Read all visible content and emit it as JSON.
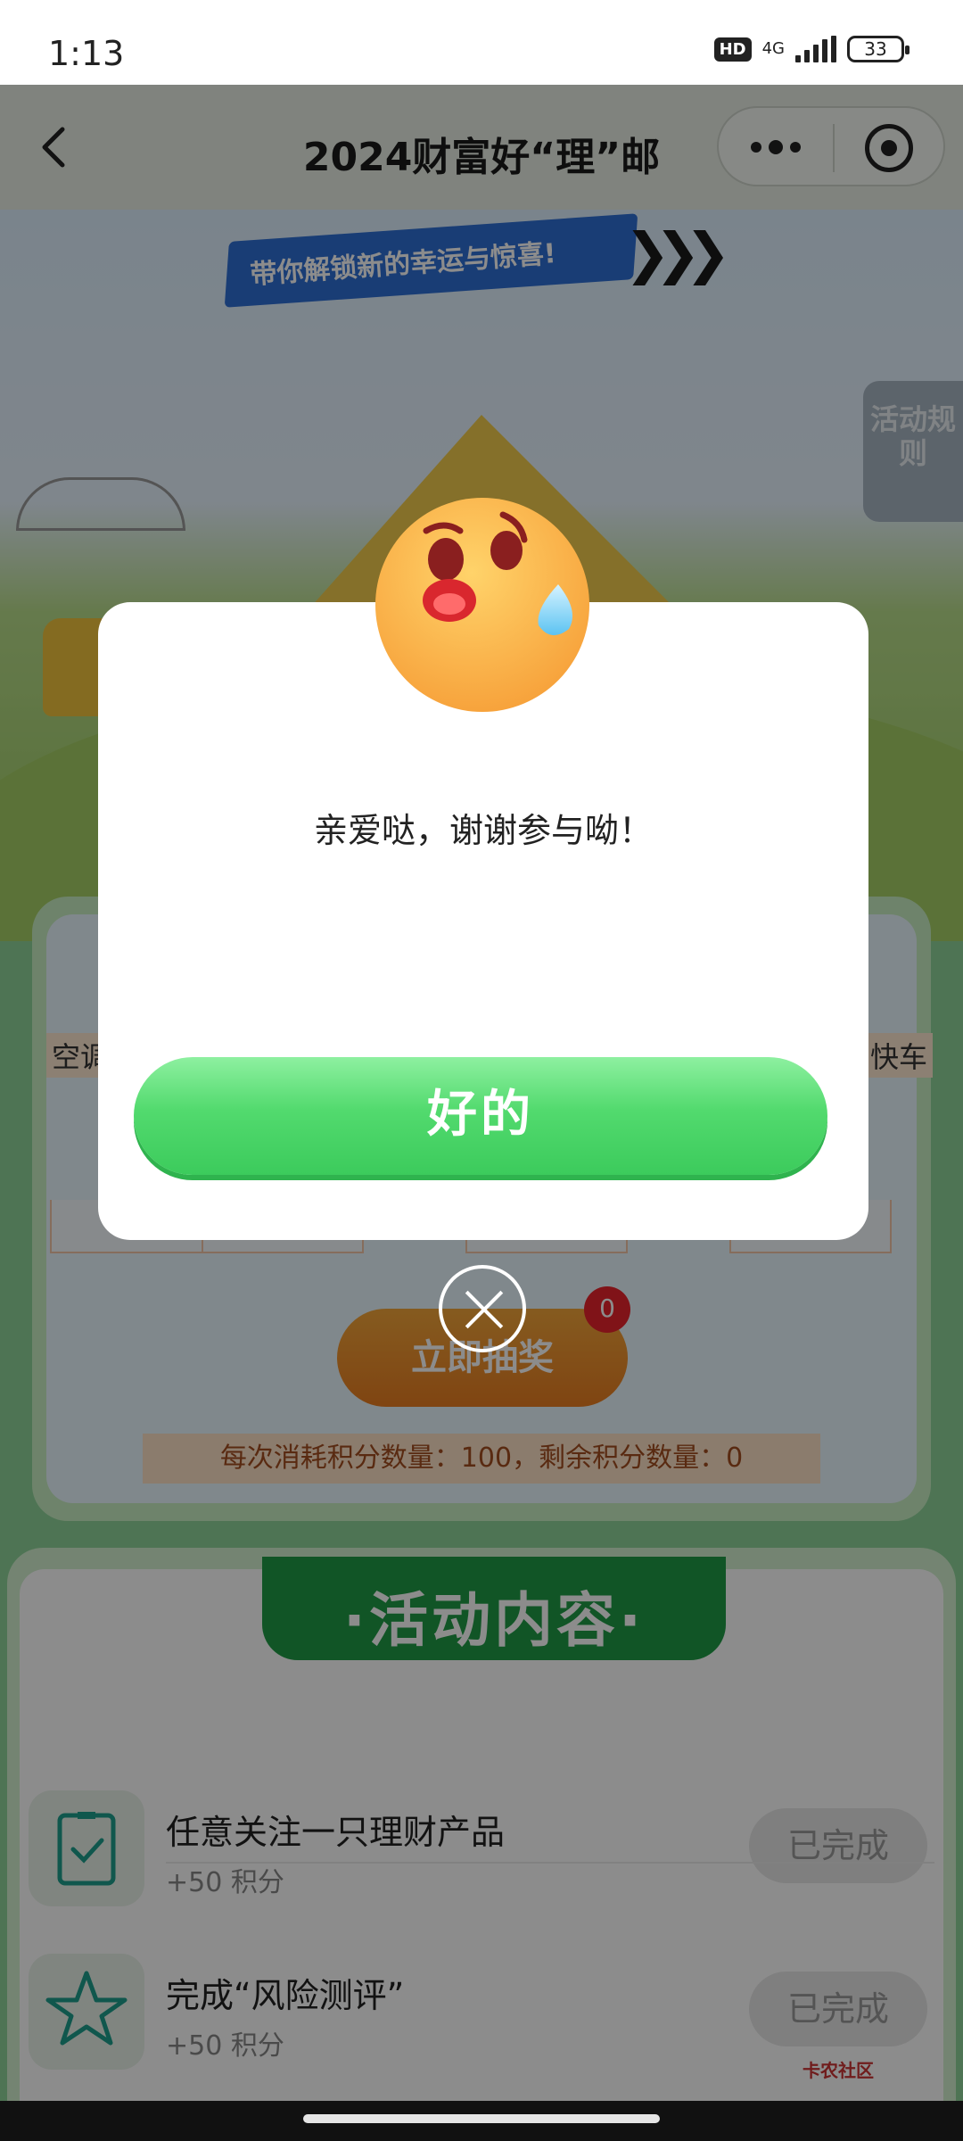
{
  "status_bar": {
    "time": "1:13",
    "hd": "HD",
    "network": "4G",
    "battery": "33"
  },
  "navbar": {
    "title": "2024财富好“理”邮"
  },
  "hero": {
    "ribbon_text": "带你解锁新的幸运与惊喜!",
    "rules_button": "活动规则"
  },
  "prize_section": {
    "label_left": "空调",
    "label_right": "快车",
    "draw_button": "立即抽奖",
    "draw_badge": "0",
    "points_info": "每次消耗积分数量：100，剩余积分数量：0"
  },
  "activity_section": {
    "title": "·活动内容·",
    "tasks": [
      {
        "title": "任意关注一只理财产品",
        "points": "+50 积分",
        "button": "已完成",
        "icon": "clipboard-check-icon"
      },
      {
        "title": "完成“风险测评”",
        "points": "+50 积分",
        "button": "已完成",
        "icon": "star-check-icon"
      }
    ]
  },
  "watermark": "卡农社区",
  "dialog": {
    "message": "亲爱哒，谢谢参与呦！",
    "ok_button": "好的",
    "emoji": "sweat-face-emoji"
  },
  "colors": {
    "ok_button_green": "#52da6e",
    "activity_green": "#1f9c45",
    "draw_orange": "#e97d21"
  }
}
